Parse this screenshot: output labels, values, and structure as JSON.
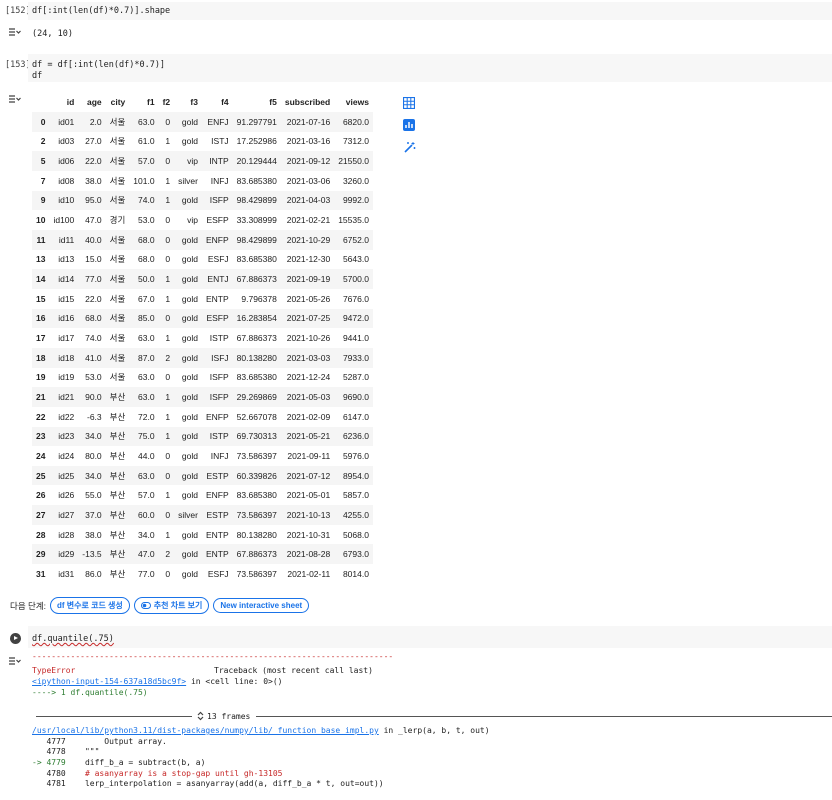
{
  "cell152": {
    "count": "[152]",
    "code": "df[:int(len(df)*0.7)].shape",
    "output": "(24, 10)"
  },
  "cell153": {
    "count": "[153]",
    "code_line1": "df = df[:int(len(df)*0.7)]",
    "code_line2": "df"
  },
  "table": {
    "columns": [
      "id",
      "age",
      "city",
      "f1",
      "f2",
      "f3",
      "f4",
      "f5",
      "subscribed",
      "views"
    ],
    "rows": [
      [
        "0",
        "id01",
        "2.0",
        "서울",
        "63.0",
        "0",
        "gold",
        "ENFJ",
        "91.297791",
        "2021-07-16",
        "6820.0"
      ],
      [
        "2",
        "id03",
        "27.0",
        "서울",
        "61.0",
        "1",
        "gold",
        "ISTJ",
        "17.252986",
        "2021-03-16",
        "7312.0"
      ],
      [
        "5",
        "id06",
        "22.0",
        "서울",
        "57.0",
        "0",
        "vip",
        "INTP",
        "20.129444",
        "2021-09-12",
        "21550.0"
      ],
      [
        "7",
        "id08",
        "38.0",
        "서울",
        "101.0",
        "1",
        "silver",
        "INFJ",
        "83.685380",
        "2021-03-06",
        "3260.0"
      ],
      [
        "9",
        "id10",
        "95.0",
        "서울",
        "74.0",
        "1",
        "gold",
        "ISFP",
        "98.429899",
        "2021-04-03",
        "9992.0"
      ],
      [
        "10",
        "id100",
        "47.0",
        "경기",
        "53.0",
        "0",
        "vip",
        "ESFP",
        "33.308999",
        "2021-02-21",
        "15535.0"
      ],
      [
        "11",
        "id11",
        "40.0",
        "서울",
        "68.0",
        "0",
        "gold",
        "ENFP",
        "98.429899",
        "2021-10-29",
        "6752.0"
      ],
      [
        "13",
        "id13",
        "15.0",
        "서울",
        "68.0",
        "0",
        "gold",
        "ESFJ",
        "83.685380",
        "2021-12-30",
        "5643.0"
      ],
      [
        "14",
        "id14",
        "77.0",
        "서울",
        "50.0",
        "1",
        "gold",
        "ENTJ",
        "67.886373",
        "2021-09-19",
        "5700.0"
      ],
      [
        "15",
        "id15",
        "22.0",
        "서울",
        "67.0",
        "1",
        "gold",
        "ENTP",
        "9.796378",
        "2021-05-26",
        "7676.0"
      ],
      [
        "16",
        "id16",
        "68.0",
        "서울",
        "85.0",
        "0",
        "gold",
        "ESFP",
        "16.283854",
        "2021-07-25",
        "9472.0"
      ],
      [
        "17",
        "id17",
        "74.0",
        "서울",
        "63.0",
        "1",
        "gold",
        "ISTP",
        "67.886373",
        "2021-10-26",
        "9441.0"
      ],
      [
        "18",
        "id18",
        "41.0",
        "서울",
        "87.0",
        "2",
        "gold",
        "ISFJ",
        "80.138280",
        "2021-03-03",
        "7933.0"
      ],
      [
        "19",
        "id19",
        "53.0",
        "서울",
        "63.0",
        "0",
        "gold",
        "ISFP",
        "83.685380",
        "2021-12-24",
        "5287.0"
      ],
      [
        "21",
        "id21",
        "90.0",
        "부산",
        "63.0",
        "1",
        "gold",
        "ISFP",
        "29.269869",
        "2021-05-03",
        "9690.0"
      ],
      [
        "22",
        "id22",
        "-6.3",
        "부산",
        "72.0",
        "1",
        "gold",
        "ENFP",
        "52.667078",
        "2021-02-09",
        "6147.0"
      ],
      [
        "23",
        "id23",
        "34.0",
        "부산",
        "75.0",
        "1",
        "gold",
        "ISTP",
        "69.730313",
        "2021-05-21",
        "6236.0"
      ],
      [
        "24",
        "id24",
        "80.0",
        "부산",
        "44.0",
        "0",
        "gold",
        "INFJ",
        "73.586397",
        "2021-09-11",
        "5976.0"
      ],
      [
        "25",
        "id25",
        "34.0",
        "부산",
        "63.0",
        "0",
        "gold",
        "ESTP",
        "60.339826",
        "2021-07-12",
        "8954.0"
      ],
      [
        "26",
        "id26",
        "55.0",
        "부산",
        "57.0",
        "1",
        "gold",
        "ENFP",
        "83.685380",
        "2021-05-01",
        "5857.0"
      ],
      [
        "27",
        "id27",
        "37.0",
        "부산",
        "60.0",
        "0",
        "silver",
        "ESTP",
        "73.586397",
        "2021-10-13",
        "4255.0"
      ],
      [
        "28",
        "id28",
        "38.0",
        "부산",
        "34.0",
        "1",
        "gold",
        "ENTP",
        "80.138280",
        "2021-10-31",
        "5068.0"
      ],
      [
        "29",
        "id29",
        "-13.5",
        "부산",
        "47.0",
        "2",
        "gold",
        "ENTP",
        "67.886373",
        "2021-08-28",
        "6793.0"
      ],
      [
        "31",
        "id31",
        "86.0",
        "부산",
        "77.0",
        "0",
        "gold",
        "ESFJ",
        "73.586397",
        "2021-02-11",
        "8014.0"
      ]
    ]
  },
  "next_steps": {
    "label": "다음 단계:",
    "chip1": "df 변수로 코드 생성",
    "chip2": "추천 차트 보기",
    "chip3": "New interactive sheet"
  },
  "cell154": {
    "code": "df.quantile(.75)"
  },
  "traceback": {
    "dashes": "---------------------------------------------------------------------------",
    "error_type": "TypeError",
    "traceback_label": "Traceback (most recent call last)",
    "input_link": "<ipython-input-154-637a18d5bc9f>",
    "input_loc": " in <cell line: 0>()",
    "arrow_line": "----> 1 df.quantile(.75)",
    "frames": "13 frames",
    "file_link": "/usr/local/lib/python3.11/dist-packages/numpy/lib/_function_base_impl.py",
    "file_loc": " in _lerp(a, b, t, out)",
    "lines": [
      {
        "no": "   4777",
        "code": "        Output array."
      },
      {
        "no": "   4778",
        "code": "    \"\"\""
      },
      {
        "no": "-> 4779",
        "code": "    diff_b_a = subtract(b, a)"
      },
      {
        "no": "   4780",
        "code": "    # asanyarray is a stop-gap until gh-13105"
      },
      {
        "no": "   4781",
        "code": "    lerp_interpolation = asanyarray(add(a, diff_b_a * t, out=out))"
      }
    ]
  },
  "colors": {
    "accent": "#1a73e8",
    "error": "#c62828"
  }
}
